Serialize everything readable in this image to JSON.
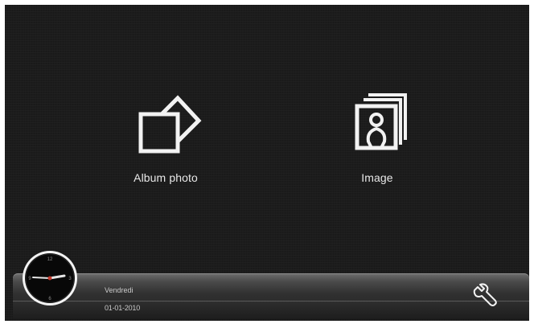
{
  "menu": {
    "album_label": "Album photo",
    "image_label": "Image"
  },
  "status": {
    "day": "Vendredi",
    "date": "01-01-2010"
  },
  "clock": {
    "numerals": [
      "12",
      "3",
      "6",
      "9"
    ],
    "time": "2:45"
  },
  "icons": {
    "album": "album-photo-icon",
    "image": "image-gallery-icon",
    "settings": "wrench-icon"
  }
}
